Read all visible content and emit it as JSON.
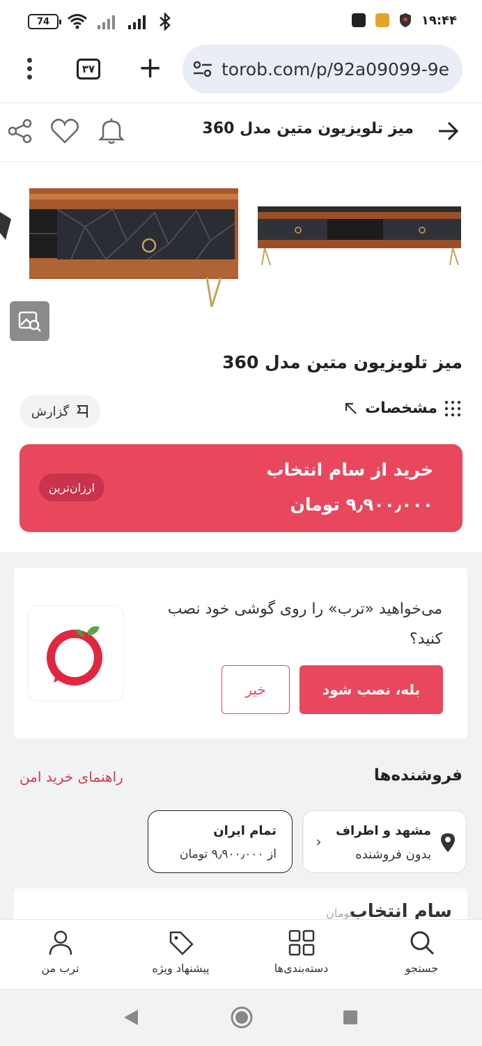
{
  "status_bar": {
    "battery": "74",
    "time": "۱۹:۴۴"
  },
  "browser": {
    "tabs_count": "۳۷",
    "url": "torob.com/p/92a09099-9e"
  },
  "header": {
    "title": "میز تلویزیون متین مدل 360"
  },
  "product": {
    "title": "میز تلویزیون متین مدل 360",
    "specs_label": "مشخصات",
    "report_label": "گزارش"
  },
  "buy_box": {
    "title": "خرید از سام انتخاب",
    "price": "۹٫۹۰۰٫۰۰۰ تومان",
    "badge": "ارزان‌ترین"
  },
  "install_prompt": {
    "text": "می‌خواهید «ترب» را روی گوشی خود نصب کنید؟",
    "yes_label": "بله، نصب شود",
    "no_label": "خیر"
  },
  "sellers": {
    "title": "فروشنده‌ها",
    "safe_guide": "راهنمای خرید امن",
    "location": {
      "name": "مشهد و اطراف",
      "sub": "بدون فروشنده"
    },
    "all_iran": {
      "name": "تمام ایران",
      "price": "از ۹٫۹۰۰٫۰۰۰ تومان"
    },
    "next_card": {
      "title": "سام انتخاب",
      "sub": "تومان"
    }
  },
  "bottom_nav": {
    "items": [
      {
        "label": "جستجو",
        "icon": "search-icon"
      },
      {
        "label": "دسته‌بندی‌ها",
        "icon": "grid-icon"
      },
      {
        "label": "پیشنهاد ویژه",
        "icon": "tag-icon"
      },
      {
        "label": "ترب من",
        "icon": "user-icon"
      }
    ]
  },
  "colors": {
    "brand": "#e9475e",
    "brand_dark": "#c8344b",
    "section_bg": "#f1f2f4"
  }
}
